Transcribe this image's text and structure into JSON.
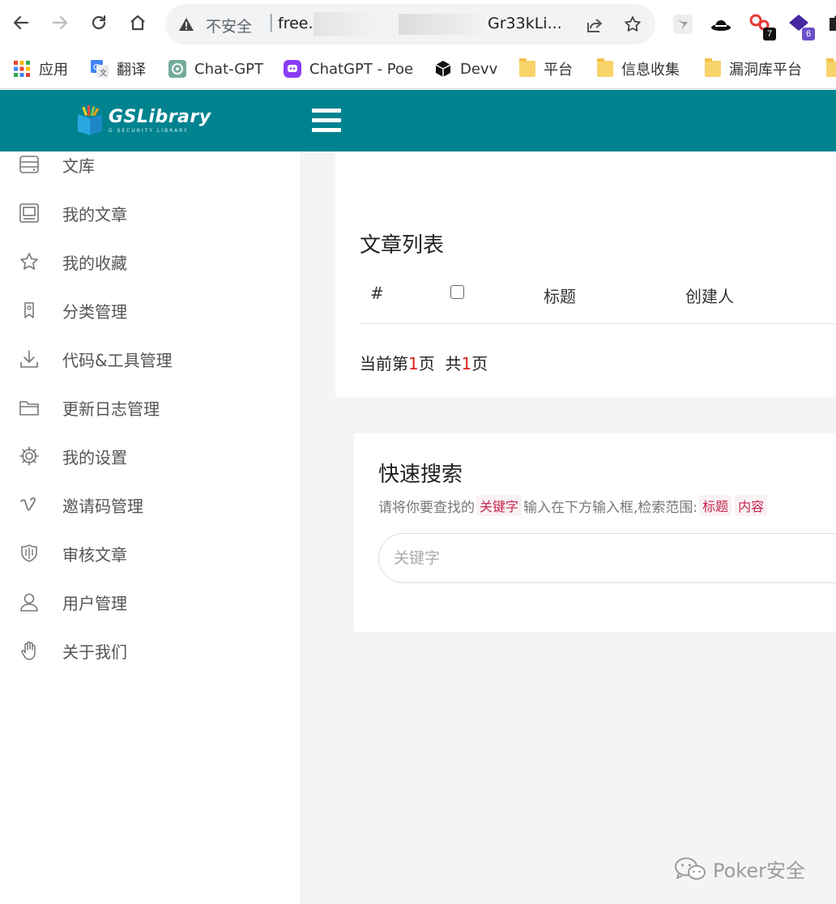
{
  "browser": {
    "security_label": "不安全",
    "url_start": "free.i",
    "url_end": "Gr33kLi...",
    "bookmarks": [
      {
        "label": "应用",
        "icon": "apps-grid-icon"
      },
      {
        "label": "翻译",
        "icon": "google-translate-icon"
      },
      {
        "label": "Chat-GPT",
        "icon": "openai-icon"
      },
      {
        "label": "ChatGPT - Poe",
        "icon": "poe-icon"
      },
      {
        "label": "Devv",
        "icon": "cube-icon"
      },
      {
        "label": "平台",
        "icon": "folder-icon"
      },
      {
        "label": "信息收集",
        "icon": "folder-icon"
      },
      {
        "label": "漏洞库平台",
        "icon": "folder-icon"
      }
    ],
    "extensions": [
      {
        "icon": "bird-extension-icon"
      },
      {
        "icon": "hat-extension-icon"
      },
      {
        "icon": "red-extension-icon",
        "badge": "7"
      },
      {
        "icon": "purple-extension-icon",
        "badge": "6"
      }
    ]
  },
  "header": {
    "logo_title": "GSLibrary",
    "logo_subtitle": "G SECURITY LIBRARY"
  },
  "sidebar": {
    "items": [
      {
        "label": "文库",
        "icon": "server-icon"
      },
      {
        "label": "我的文章",
        "icon": "document-icon"
      },
      {
        "label": "我的收藏",
        "icon": "star-icon"
      },
      {
        "label": "分类管理",
        "icon": "bookmark-icon"
      },
      {
        "label": "代码&工具管理",
        "icon": "download-icon"
      },
      {
        "label": "更新日志管理",
        "icon": "folder-icon"
      },
      {
        "label": "我的设置",
        "icon": "gear-icon"
      },
      {
        "label": "邀请码管理",
        "icon": "vimeo-icon"
      },
      {
        "label": "审核文章",
        "icon": "shield-icon"
      },
      {
        "label": "用户管理",
        "icon": "user-icon"
      },
      {
        "label": "关于我们",
        "icon": "hand-icon"
      }
    ]
  },
  "article_list": {
    "title": "文章列表",
    "columns": [
      "#",
      "标题",
      "创建人"
    ],
    "pager_prefix": "当前第",
    "current_page": "1",
    "pager_mid": "页  共",
    "total_pages": "1",
    "pager_suffix": "页"
  },
  "quick_search": {
    "title": "快速搜索",
    "desc_prefix": "请将你要查找的",
    "keyword_tag": "关键字",
    "desc_mid": "输入在下方输入框,检索范围:",
    "scope_tags": [
      "标题",
      "内容"
    ],
    "placeholder": "关键字"
  },
  "watermark": {
    "text": "Poker安全"
  },
  "colors": {
    "header_teal": "#00838f",
    "accent_red": "#e0201a",
    "tag_text": "#c7254e"
  }
}
